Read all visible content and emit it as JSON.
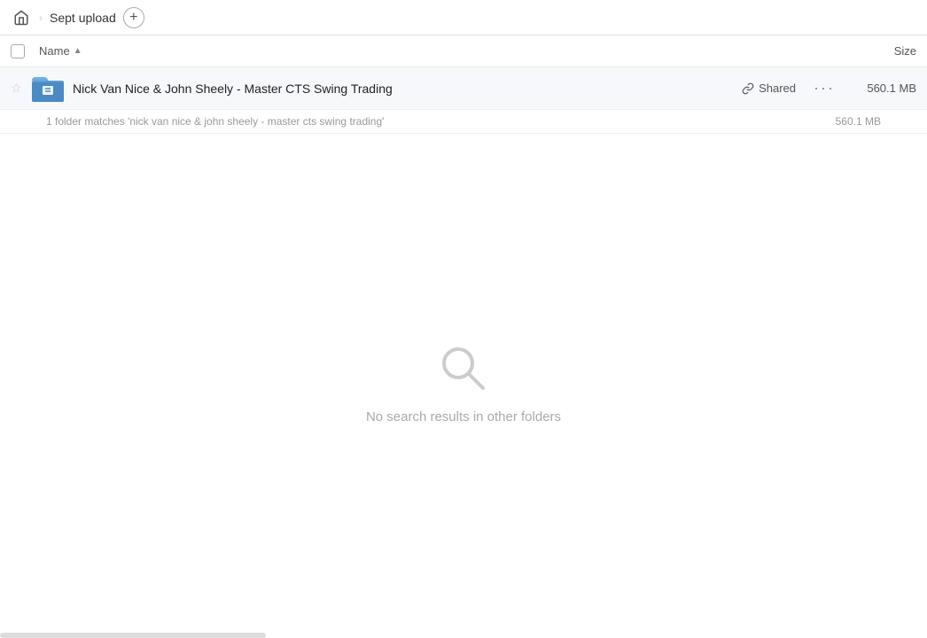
{
  "topbar": {
    "home_label": "Home",
    "title": "Sept upload",
    "add_label": "+"
  },
  "columns": {
    "name_label": "Name",
    "sort_indicator": "▲",
    "size_label": "Size"
  },
  "file": {
    "name": "Nick Van Nice & John Sheely - Master CTS Swing Trading",
    "shared_label": "Shared",
    "size": "560.1 MB",
    "match_text": "1 folder matches 'nick van nice & john sheely - master cts swing trading'",
    "match_size": "560.1 MB"
  },
  "no_results": {
    "text": "No search results in other folders"
  },
  "icons": {
    "home": "⌂",
    "star": "☆",
    "more": "•••",
    "link": "🔗"
  }
}
